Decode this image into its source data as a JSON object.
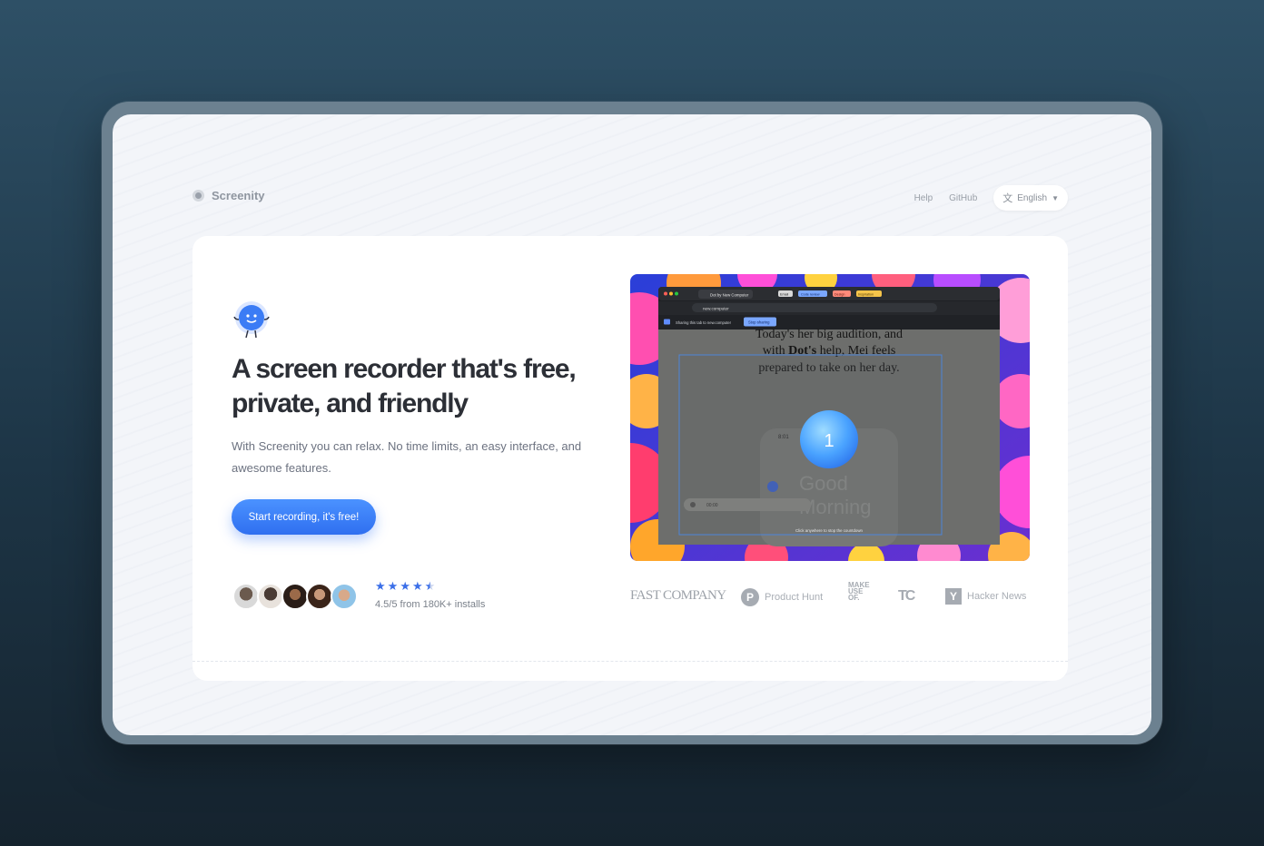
{
  "header": {
    "logo_text": "Screenity",
    "nav": {
      "help": "Help",
      "github": "GitHub",
      "language": "English"
    }
  },
  "hero": {
    "headline": "A screen recorder that's free, private, and friendly",
    "subtitle": "With Screenity you can relax. No time limits, an easy interface, and awesome features.",
    "cta_label": "Start recording, it's free!",
    "rating_text": "4.5/5 from 180K+ installs",
    "rating_stars": 4.5
  },
  "preview": {
    "story_text_line1": "Today's her big audition, and",
    "story_text_line2_prefix": "with ",
    "story_text_line2_bold": "Dot's",
    "story_text_line2_suffix": " help, Mei feels",
    "story_text_line3": "prepared to take on her day.",
    "countdown": "1",
    "phone_time": "8:01",
    "phone_greeting_1": "Good",
    "phone_greeting_2": "Morning",
    "tab_title": "Dot by New Computer",
    "tab_chips": [
      "Email",
      "Code review",
      "Design",
      "Inspiration"
    ],
    "url": "new.computer",
    "share_banner": "Sharing this tab to new.computer",
    "share_button": "Stop sharing",
    "countdown_hint": "Click anywhere to stop the countdown",
    "toolbar_time": "00:00"
  },
  "press": {
    "fast_company": "FAST COMPANY",
    "product_hunt": "Product Hunt",
    "product_hunt_letter": "P",
    "makeuseof": [
      "MAKE",
      "USE",
      "OF."
    ],
    "techcrunch": "TC",
    "hacker_news_letter": "Y",
    "hacker_news": "Hacker News"
  },
  "colors": {
    "background_top": "#2e5066",
    "background_bottom": "#15232e",
    "accent": "#3a79f5",
    "star": "#3b6fe8"
  }
}
